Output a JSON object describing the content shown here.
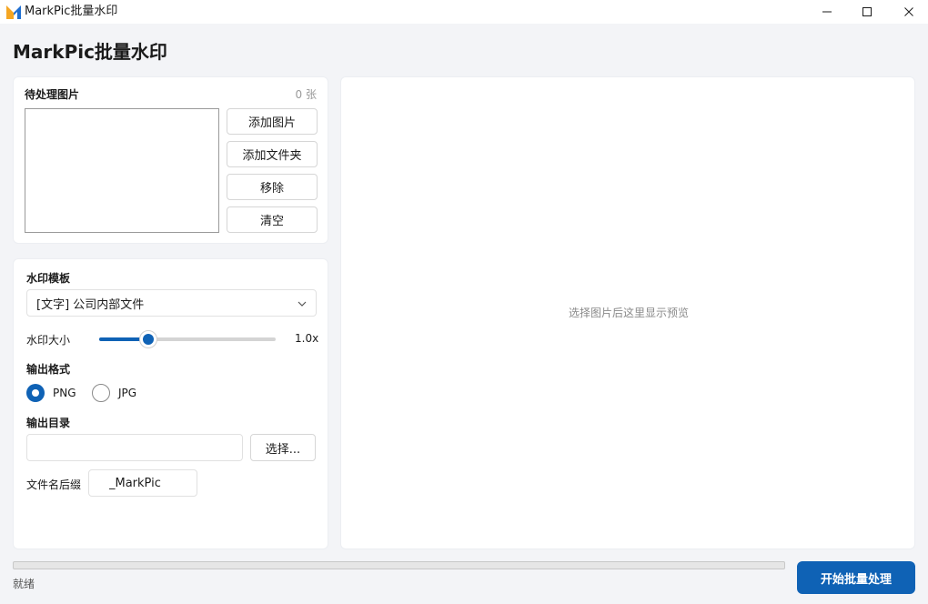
{
  "window": {
    "title": "MarkPic批量水印",
    "logo_letter": "M"
  },
  "header": {
    "title": "MarkPic批量水印"
  },
  "images_panel": {
    "title": "待处理图片",
    "count": "0 张",
    "buttons": {
      "add_images": "添加图片",
      "add_folder": "添加文件夹",
      "remove": "移除",
      "clear": "清空"
    }
  },
  "settings": {
    "template_label": "水印模板",
    "template_selected": "[文字] 公司内部文件",
    "size_label": "水印大小",
    "size_value": "1.0x",
    "size_fraction": 0.28,
    "format_label": "输出格式",
    "format_options": [
      "PNG",
      "JPG"
    ],
    "format_selected": "PNG",
    "output_dir_label": "输出目录",
    "output_dir_value": "",
    "browse_button": "选择...",
    "suffix_label": "文件名后缀",
    "suffix_value": "_MarkPic"
  },
  "preview": {
    "placeholder": "选择图片后这里显示预览"
  },
  "footer": {
    "status": "就绪",
    "progress": 0,
    "start_button": "开始批量处理"
  },
  "colors": {
    "accent": "#0f62b5",
    "logo_orange": "#f5a623",
    "logo_blue": "#1f6fd1"
  }
}
